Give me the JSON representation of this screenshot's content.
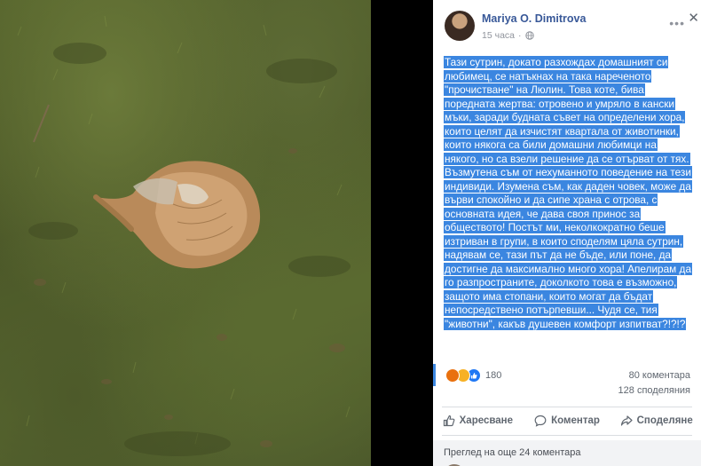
{
  "post": {
    "author": "Mariya O. Dimitrova",
    "time": "15 часа",
    "text": "Тази сутрин, докато разхождах домашният си любимец, се натъкнах на така нареченото \"прочистване\" на Люлин. Това коте, бива поредната жертва: отровено и умряло в кански мъки, заради будната съвет на определени хора, които целят да изчистят квартала от животинки, които някога са били домашни любимци на някого, но са взели решение да се отърват от тях. Възмутена съм от нехуманното поведение на тези индивиди. Изумена съм, как даден човек, може да върви спокойно и да сипе храна с отрова, с основната идея, че дава своя принос за обществото! Постът ми, неколкократно беше изтриван в групи, в които споделям цяла сутрин, надявам се, тази път да не бъде, или поне, да достигне да максимално много хора! Апелирам да го разпространите, доколкото това е възможно, защото има стопани, които могат да бъдат непосредствено потърпевши... Чудя се, тия \"животни\", какъв душевен комфорт изпитват?!?!?"
  },
  "stats": {
    "reaction_count": "180",
    "comments": "80 коментара",
    "shares": "128 споделяния"
  },
  "actions": {
    "like": "Харесване",
    "comment": "Коментар",
    "share": "Споделяне"
  },
  "footer": {
    "more_comments": "Преглед на още 24 коментара"
  },
  "icons": {
    "more": "more-icon",
    "close": "close-icon",
    "globe": "globe-icon"
  },
  "colors": {
    "selection": "#3b86e0",
    "author": "#385898",
    "photo_grass": "#55632c"
  }
}
